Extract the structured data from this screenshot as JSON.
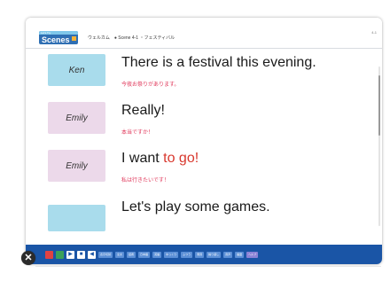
{
  "header": {
    "badge_label": "Scenes",
    "badge_top": "Let's Try",
    "subtitle": "ウェルカム　● Scene 4-1 ・フェスティバル",
    "corner": "4-1"
  },
  "dialogue": [
    {
      "speaker": "Ken",
      "speaker_color": "blue",
      "english_plain": "There is a festival this evening.",
      "english_highlight": "",
      "english_after": "",
      "japanese": "今夜お祭りがあります。"
    },
    {
      "speaker": "Emily",
      "speaker_color": "pink",
      "english_plain": "Really!",
      "english_highlight": "",
      "english_after": "",
      "japanese": "本当ですか！"
    },
    {
      "speaker": "Emily",
      "speaker_color": "pink",
      "english_plain": "I want ",
      "english_highlight": "to go!",
      "english_after": "",
      "japanese": "私は行きたいです！"
    },
    {
      "speaker": "",
      "speaker_color": "blue",
      "english_plain": "Let's play some games.",
      "english_highlight": "",
      "english_after": "",
      "japanese": ""
    }
  ],
  "toolbar": {
    "play_glyph": "▶",
    "stop_glyph": "■",
    "sound_glyph": "◀",
    "segments": [
      "表示切替",
      "全文",
      "話者",
      "日本語",
      "英語",
      "ゆっくり",
      "ふつう",
      "発音",
      "繰り返し",
      "音声",
      "語彙",
      "ヘルプ"
    ]
  },
  "close": {
    "glyph": "✕"
  },
  "colors": {
    "toolbar": "#1a55a6",
    "highlight_red": "#d8372d",
    "japanese_pink": "#e0375a",
    "speaker_blue": "#a9dcec",
    "speaker_pink": "#ecd9ea"
  }
}
